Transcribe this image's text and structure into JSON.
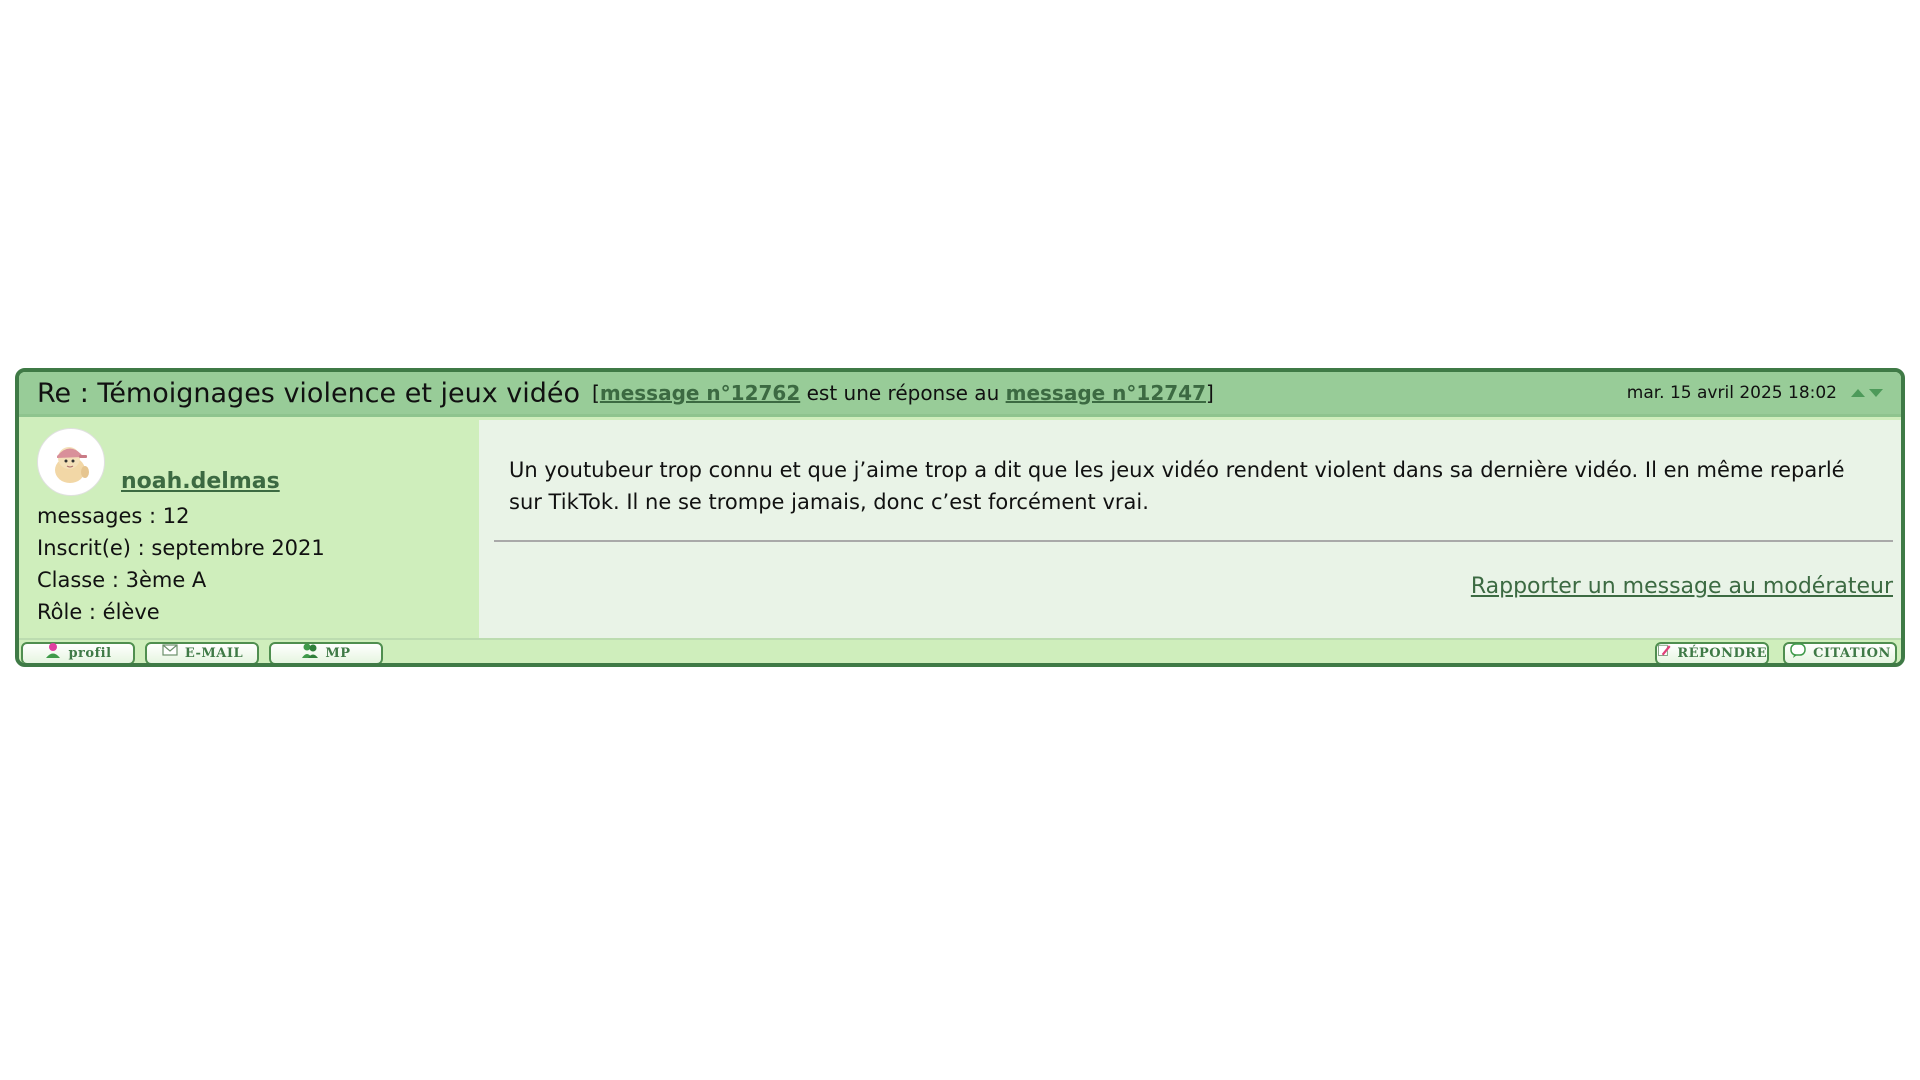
{
  "post": {
    "title": "Re : Témoignages violence et jeux vidéo",
    "ref": {
      "open": "[",
      "message_link": "message n°12762",
      "middle": " est une réponse au ",
      "reply_to_link": "message n°12747",
      "close": "]"
    },
    "date": "mar. 15 avril 2025 18:02"
  },
  "author": {
    "name": "noah.delmas",
    "messages": "messages : 12",
    "registered": "Inscrit(e) : septembre 2021",
    "class": "Classe : 3ème A",
    "role": "Rôle : élève"
  },
  "message": {
    "text": "Un youtubeur trop connu et que j’aime trop a dit que les jeux vidéo rendent violent dans sa dernière vidéo. Il en même reparlé sur TikTok. Il ne se trompe jamais, donc c’est forcément vrai.",
    "report_link": "Rapporter un message au modérateur"
  },
  "footer": {
    "left_buttons": [
      {
        "label": "profil",
        "icon": "profile-icon"
      },
      {
        "label": "E-MAIL",
        "icon": "email-icon"
      },
      {
        "label": "MP",
        "icon": "private-message-icon"
      }
    ],
    "right_buttons": [
      {
        "label": "RÉPONDRE",
        "icon": "reply-pen-icon"
      },
      {
        "label": "CITATION",
        "icon": "quote-icon"
      }
    ]
  },
  "colors": {
    "border": "#3f7a46",
    "header_bg": "#98cc98",
    "author_bg": "#cfeebc",
    "message_bg": "#e9f3e7",
    "link": "#3c6a42"
  }
}
